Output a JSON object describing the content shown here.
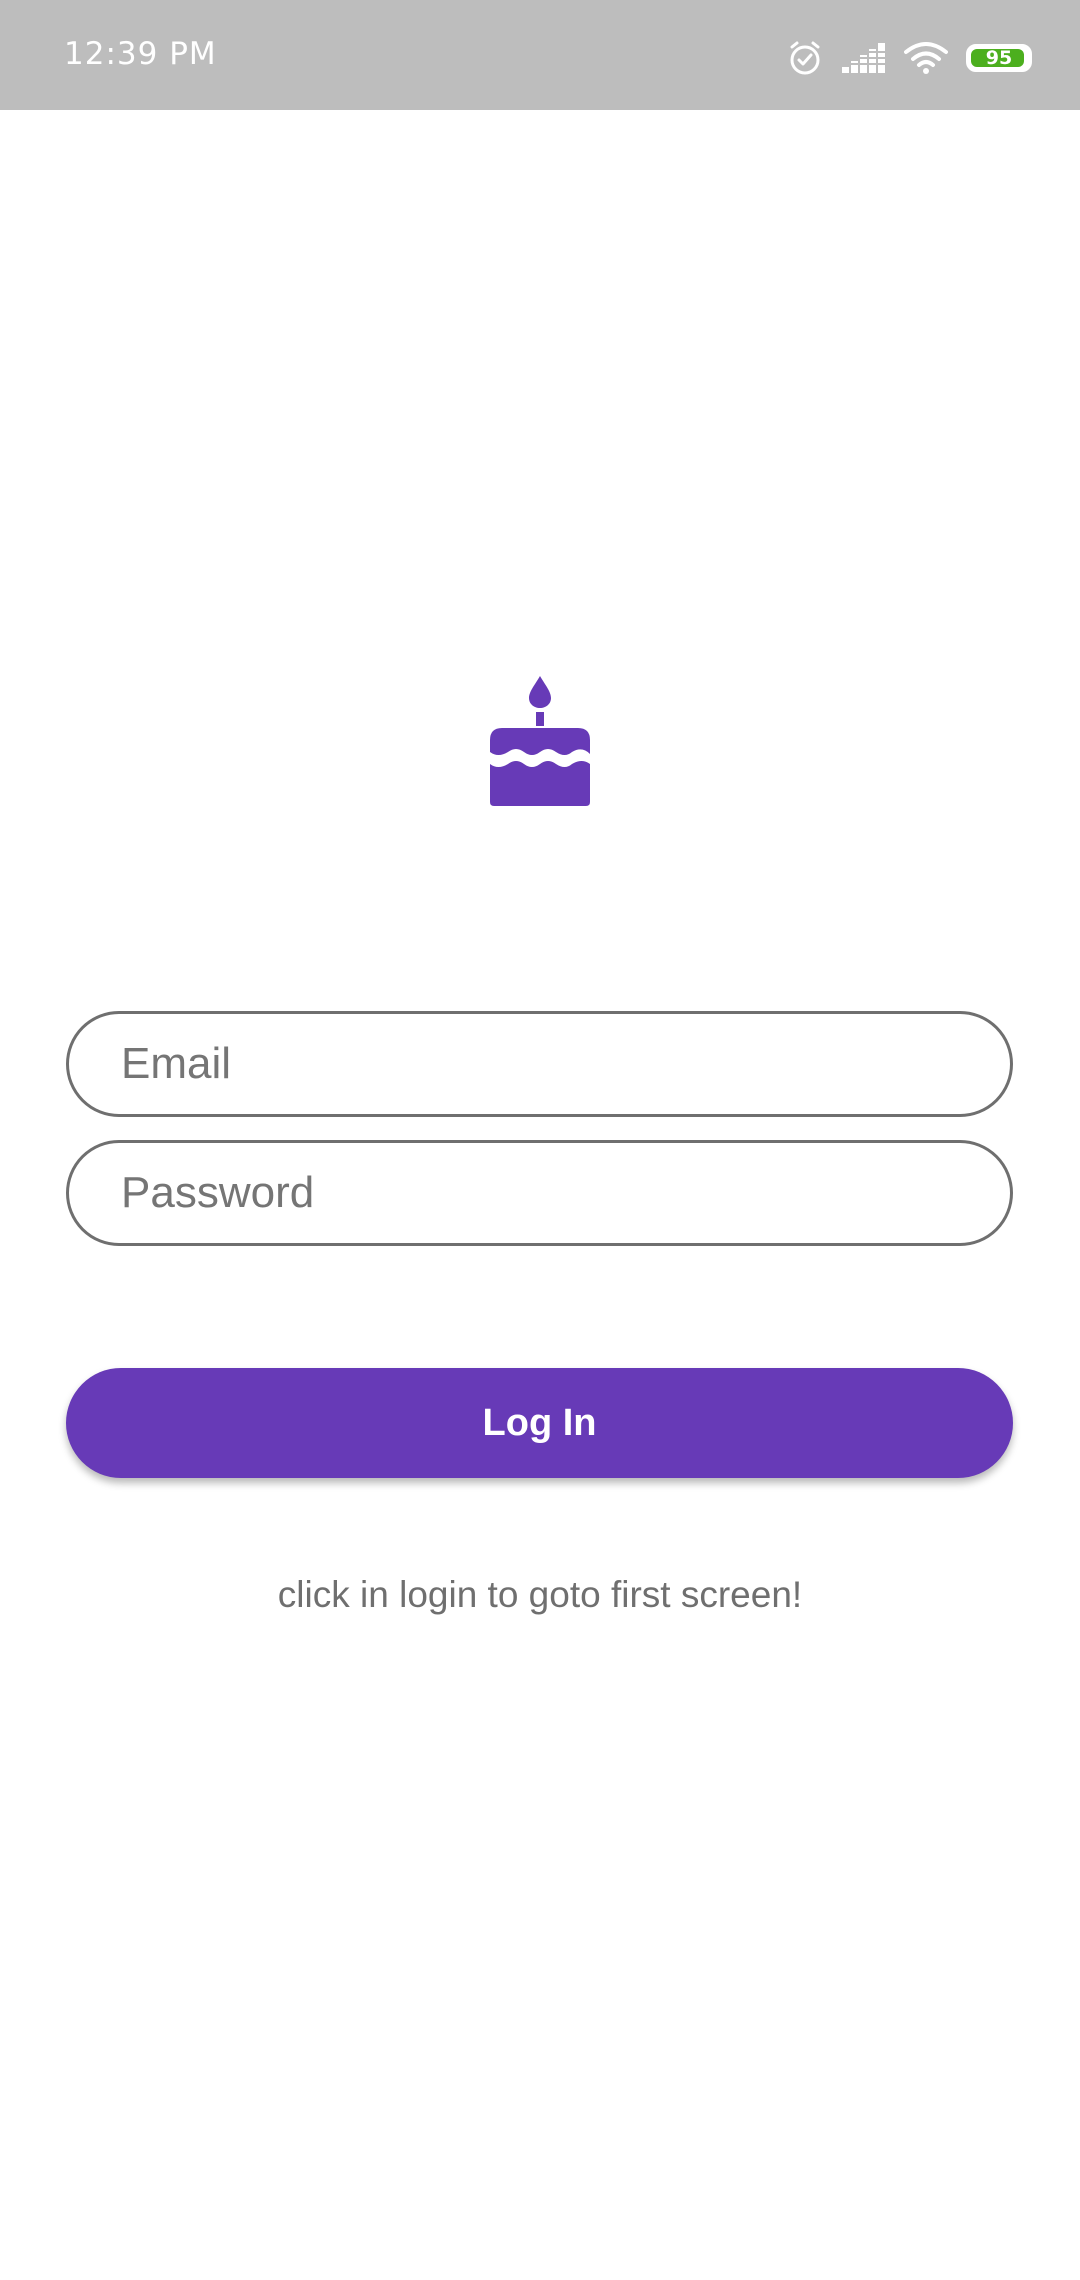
{
  "status_bar": {
    "time": "12:39 PM",
    "battery_level": "95",
    "battery_fraction": 0.95,
    "icons": [
      "alarm-icon",
      "signal-icon",
      "wifi-icon",
      "battery-icon"
    ]
  },
  "logo": {
    "icon": "cake-icon",
    "color": "#673ab7"
  },
  "form": {
    "email": {
      "value": "",
      "placeholder": "Email"
    },
    "password": {
      "value": "",
      "placeholder": "Password"
    },
    "login_label": "Log In"
  },
  "hint": "click in login to goto first screen!",
  "colors": {
    "accent": "#673ab7",
    "status_bar": "#bdbdbd",
    "border": "#6f6f6f",
    "text_secondary": "#6f6f6f",
    "battery": "#4caf1e"
  }
}
